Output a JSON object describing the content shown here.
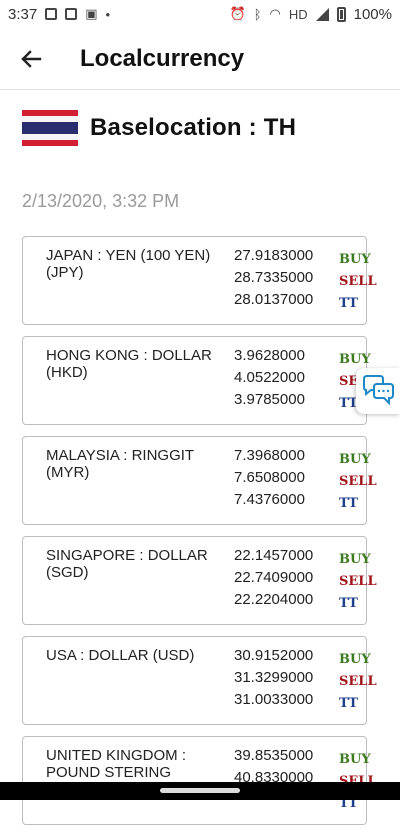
{
  "status_bar": {
    "time": "3:37",
    "battery": "100%",
    "network": "HD"
  },
  "app_bar": {
    "title": "Localcurrency",
    "back_icon": "arrow-left-icon"
  },
  "base_location": {
    "label": "Baselocation  :  TH",
    "flag": "thailand-flag"
  },
  "timestamp": "2/13/2020, 3:32 PM",
  "tags": {
    "buy": "BUY",
    "sell": "SELL",
    "tt": "TT"
  },
  "colors": {
    "buy": "#3d7a1f",
    "sell": "#a1141a",
    "tt": "#1e3f8c"
  },
  "currencies": [
    {
      "name": "JAPAN : YEN (100 YEN) (JPY)",
      "buy": "27.9183000",
      "sell": "28.7335000",
      "tt": "28.0137000"
    },
    {
      "name": "HONG KONG : DOLLAR (HKD)",
      "buy": "3.9628000",
      "sell": "4.0522000",
      "tt": "3.9785000"
    },
    {
      "name": "MALAYSIA : RINGGIT (MYR)",
      "buy": "7.3968000",
      "sell": "7.6508000",
      "tt": "7.4376000"
    },
    {
      "name": "SINGAPORE : DOLLAR (SGD)",
      "buy": "22.1457000",
      "sell": "22.7409000",
      "tt": "22.2204000"
    },
    {
      "name": "USA : DOLLAR (USD)",
      "buy": "30.9152000",
      "sell": "31.3299000",
      "tt": "31.0033000"
    },
    {
      "name": "UNITED KINGDOM : POUND STERING",
      "buy": "39.8535000",
      "sell": "40.8330000",
      "tt": ""
    }
  ],
  "chat_icon": "chat-bubbles-icon"
}
